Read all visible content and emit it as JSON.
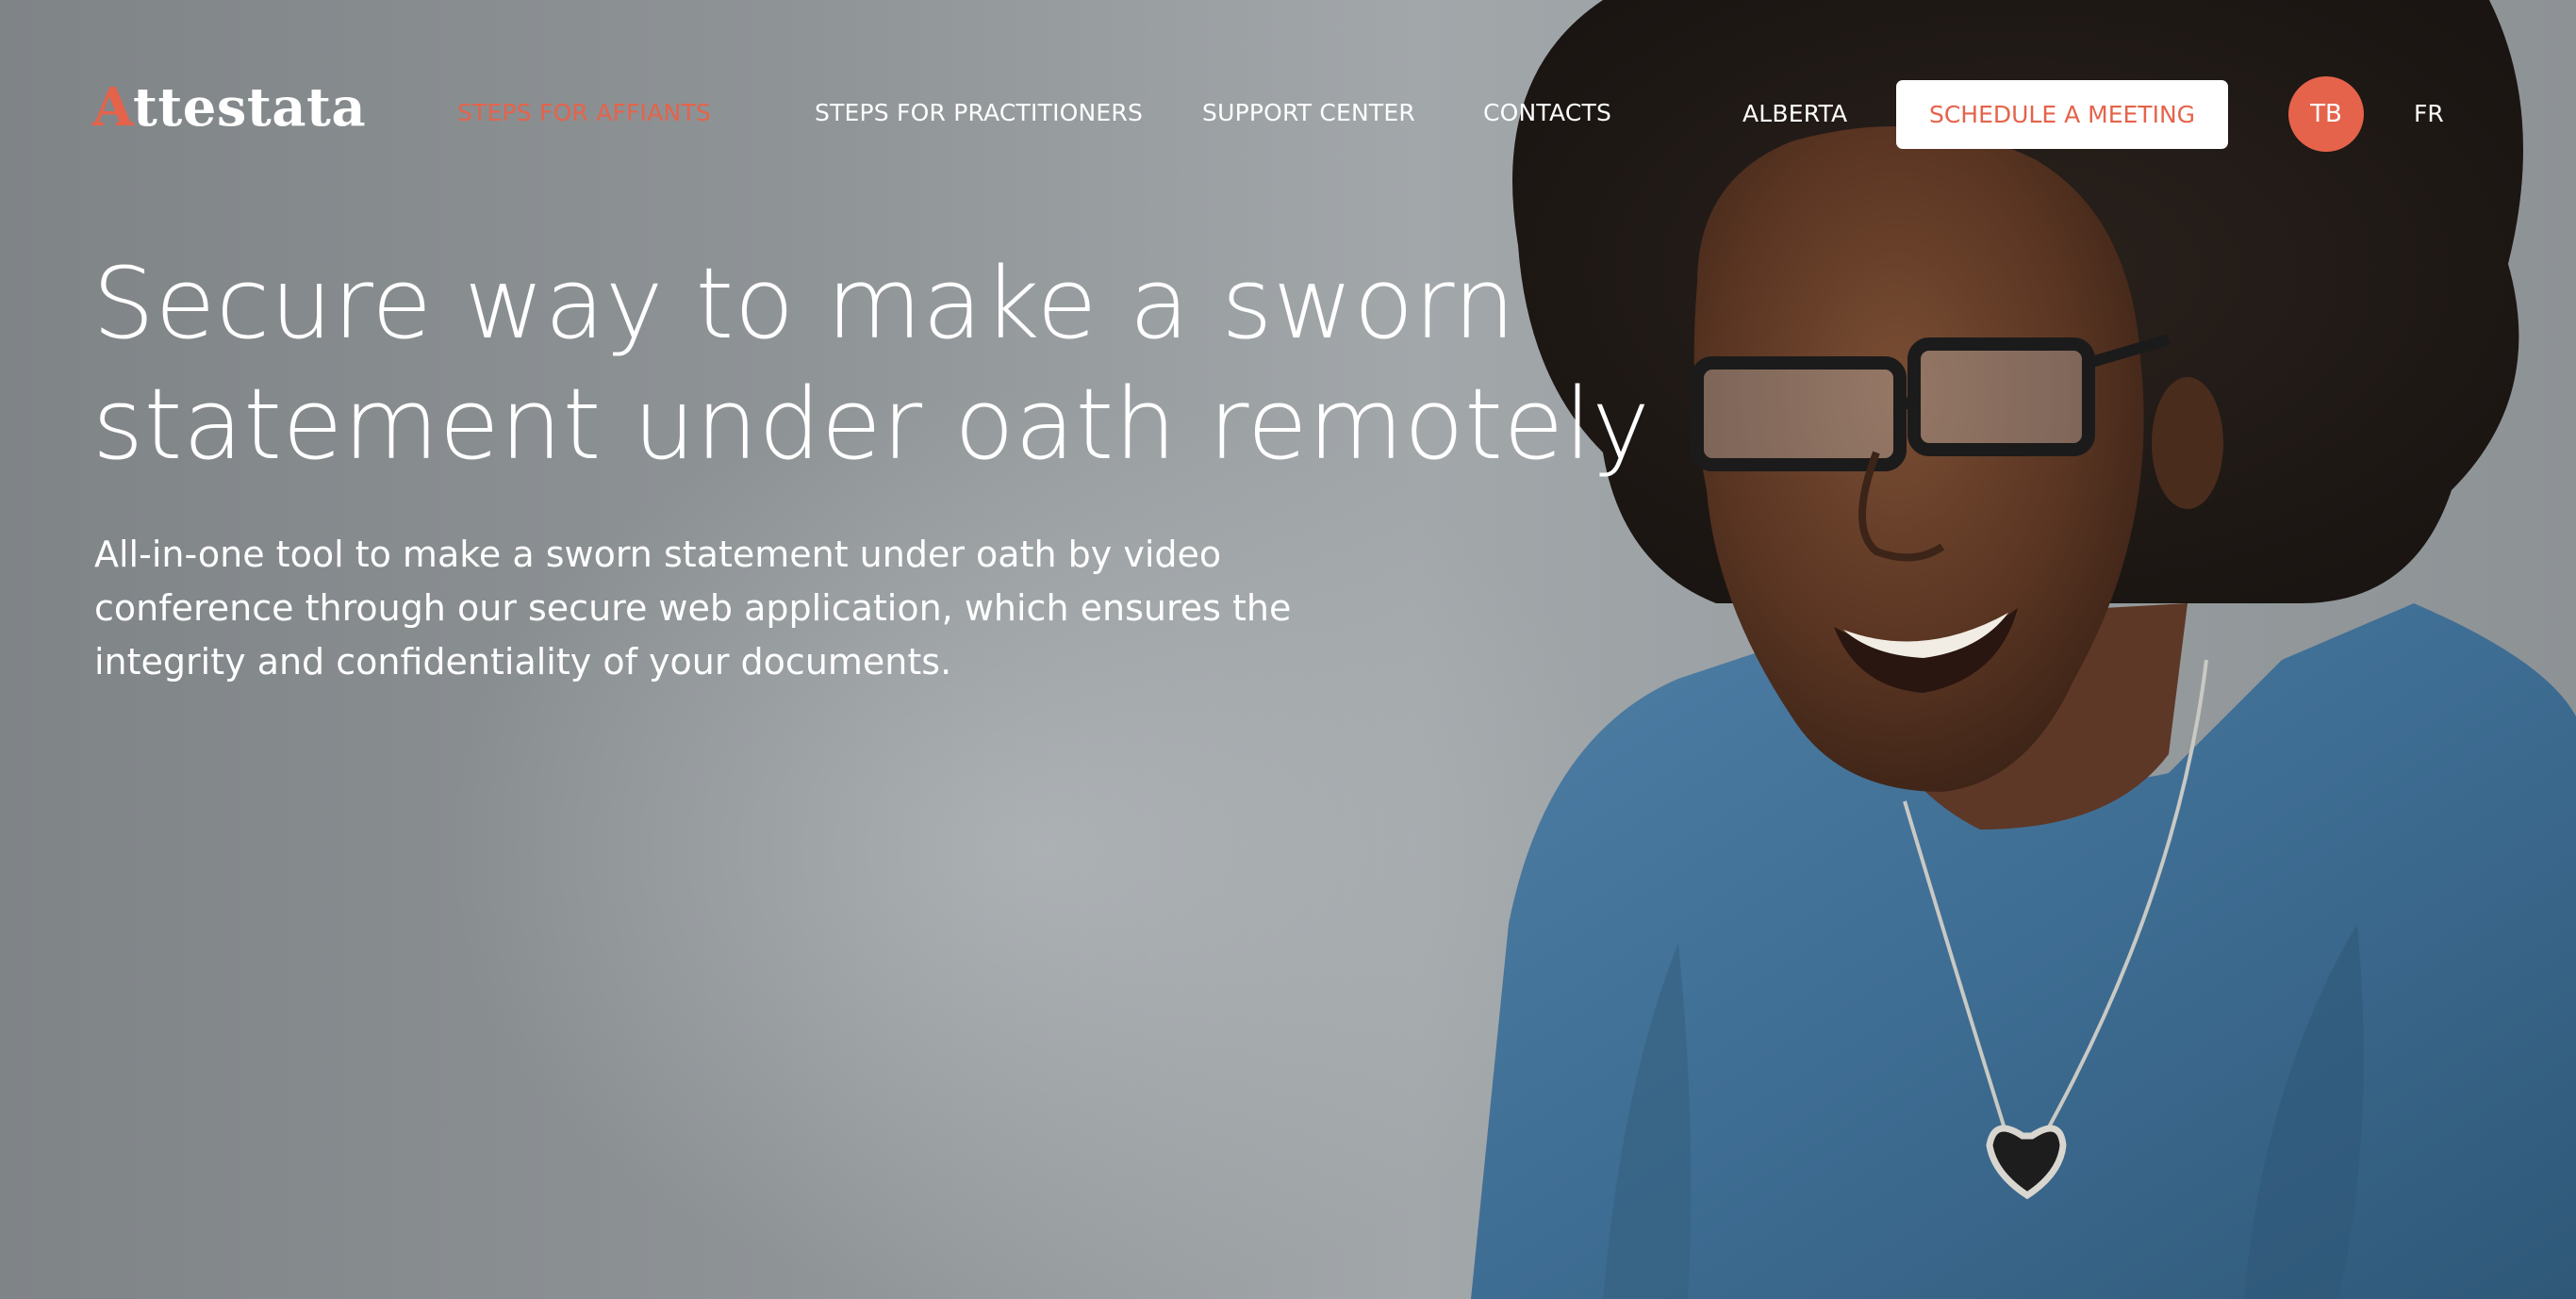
{
  "brand": {
    "logo_first_letter": "A",
    "logo_rest": "ttestata",
    "accent": "#e5634a"
  },
  "nav": {
    "items": [
      {
        "label": "STEPS FOR AFFIANTS",
        "active": true
      },
      {
        "label": "STEPS FOR PRACTITIONERS",
        "active": false
      },
      {
        "label": "SUPPORT CENTER",
        "active": false
      },
      {
        "label": "CONTACTS",
        "active": false
      }
    ],
    "region": "ALBERTA",
    "cta_label": "SCHEDULE A MEETING",
    "avatar_initials": "TB",
    "language": "FR"
  },
  "hero": {
    "title_line1": "Secure way to make a sworn",
    "title_line2": "statement under oath remotely",
    "subtitle_line1": "All-in-one tool to make a sworn statement under oath by video",
    "subtitle_line2": "conference through our secure web application, which ensures the",
    "subtitle_line3": "integrity and confidentiality of your documents."
  }
}
